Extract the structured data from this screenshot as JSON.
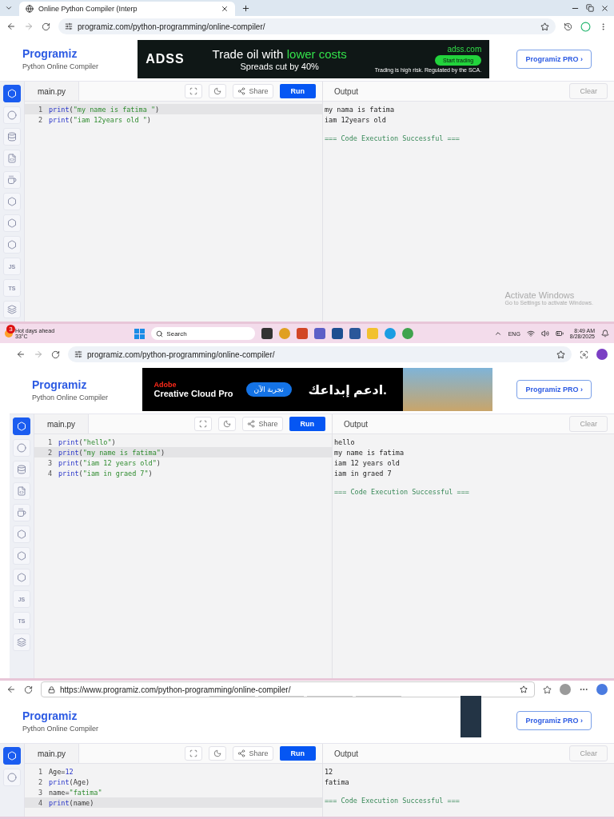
{
  "bands": [
    {
      "kind": "page",
      "browser": {
        "kind": "chrome-tabs",
        "tab_title": "Online Python Compiler (Interp",
        "url": "programiz.com/python-programming/online-compiler/"
      },
      "header": {
        "logo": "Programiz",
        "subtitle": "Python Online Compiler",
        "pro_button": "Programiz PRO ›",
        "ad": {
          "kind": "trading",
          "brand": "ADSS",
          "headline": "Trade oil with",
          "highlight": "lower costs",
          "subline": "Spreads cut by 40%",
          "domain": "adss.com",
          "cta": "Start trading",
          "disclaimer": "Trading is high risk. Regulated by the SCA."
        }
      },
      "sidebar": [
        {
          "kind": "python",
          "selected": true
        },
        {
          "kind": "r",
          "selected": false
        },
        {
          "kind": "database",
          "selected": false
        },
        {
          "kind": "html",
          "selected": false
        },
        {
          "kind": "java",
          "selected": false
        },
        {
          "kind": "hexagon",
          "selected": false
        },
        {
          "kind": "hexagon",
          "selected": false
        },
        {
          "kind": "hexagon",
          "selected": false
        },
        {
          "kind": "text",
          "label": "JS",
          "selected": false
        },
        {
          "kind": "text",
          "label": "TS",
          "selected": false
        },
        {
          "kind": "layers",
          "selected": false
        }
      ],
      "editor": {
        "file_tab": "main.py",
        "share": "Share",
        "run": "Run",
        "output_label": "Output",
        "clear": "Clear",
        "lines": [
          {
            "number": "1",
            "code": "print(\"my name is fatima \")",
            "active": true
          },
          {
            "number": "2",
            "code": "print(\"iam 12years old \")",
            "active": false
          }
        ],
        "output": [
          "my nama is fatima",
          "iam 12years old"
        ],
        "status": "=== Code Execution Successful ==="
      },
      "watermark": {
        "title": "Activate Windows",
        "subtitle": "Go to Settings to activate Windows."
      }
    },
    {
      "kind": "taskbar",
      "badge": "3",
      "weather": "Hot days ahead",
      "temperature": "33°C",
      "search": "Search",
      "language": "ENG",
      "time": "8:49 AM",
      "date": "8/28/2025"
    },
    {
      "kind": "page",
      "browser": {
        "kind": "chrome-bar",
        "url": "programiz.com/python-programming/online-compiler/"
      },
      "header": {
        "logo": "Programiz",
        "subtitle": "Python Online Compiler",
        "pro_button": "Programiz PRO ›",
        "ad": {
          "kind": "creative",
          "brand": "Adobe",
          "product": "Creative Cloud Pro",
          "cta": "تجربة الآن",
          "headline": "ادعم إبداعك."
        }
      },
      "sidebar": [
        {
          "kind": "python",
          "selected": true
        },
        {
          "kind": "r",
          "selected": false
        },
        {
          "kind": "database",
          "selected": false
        },
        {
          "kind": "html",
          "selected": false
        },
        {
          "kind": "java",
          "selected": false
        },
        {
          "kind": "hexagon",
          "selected": false
        },
        {
          "kind": "hexagon",
          "selected": false
        },
        {
          "kind": "hexagon",
          "selected": false
        },
        {
          "kind": "text",
          "label": "JS",
          "selected": false
        },
        {
          "kind": "text",
          "label": "TS",
          "selected": false
        },
        {
          "kind": "layers",
          "selected": false
        }
      ],
      "editor": {
        "file_tab": "main.py",
        "share": "Share",
        "run": "Run",
        "output_label": "Output",
        "clear": "Clear",
        "lines": [
          {
            "number": "1",
            "code": "print(\"hello\")",
            "active": false
          },
          {
            "number": "2",
            "code": "print(\"my name is fatima\")",
            "active": true
          },
          {
            "number": "3",
            "code": "print(\"iam 12 years old\")",
            "active": false
          },
          {
            "number": "4",
            "code": "print(\"iam in graed 7\")",
            "active": false
          }
        ],
        "output": [
          "hello",
          "my name is fatima",
          "iam 12 years old",
          "iam in graed 7"
        ],
        "status": "=== Code Execution Successful ==="
      }
    },
    {
      "kind": "page",
      "browser": {
        "kind": "edge",
        "url": "https://www.programiz.com/python-programming/online-compiler/"
      },
      "header": {
        "logo": "Programiz",
        "subtitle": "Python Online Compiler",
        "pro_button": "Programiz PRO ›",
        "ad": {
          "kind": "loading"
        }
      },
      "sidebar": [
        {
          "kind": "python",
          "selected": true
        },
        {
          "kind": "r",
          "selected": false
        }
      ],
      "editor": {
        "file_tab": "main.py",
        "share": "Share",
        "run": "Run",
        "output_label": "Output",
        "clear": "Clear",
        "lines": [
          {
            "number": "1",
            "code": "Age=12",
            "active": false
          },
          {
            "number": "2",
            "code": "print(Age)",
            "active": false
          },
          {
            "number": "3",
            "code": "name=\"fatima\"",
            "active": false
          },
          {
            "number": "4",
            "code": "print(name)",
            "active": true
          }
        ],
        "output": [
          "12",
          "fatima"
        ],
        "status": "=== Code Execution Successful ==="
      }
    }
  ]
}
